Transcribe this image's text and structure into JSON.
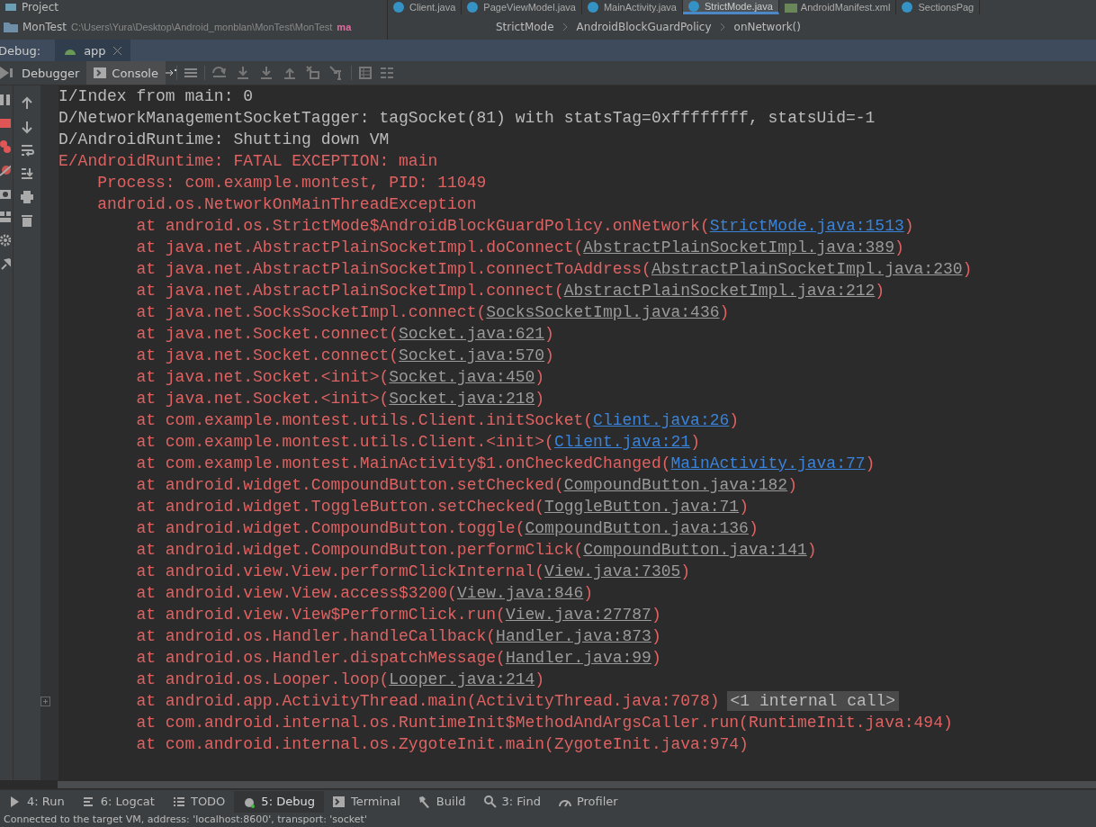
{
  "project_bar": {
    "title": "Project",
    "module": "MonTest",
    "path": "C:\\Users\\Yura\\Desktop\\Android_monblan\\MonTest\\MonTest",
    "branch": "ma"
  },
  "editor_tabs": [
    {
      "label": "Client.java",
      "kind": "class",
      "selected": false
    },
    {
      "label": "PageViewModel.java",
      "kind": "class",
      "selected": false
    },
    {
      "label": "MainActivity.java",
      "kind": "class",
      "selected": false
    },
    {
      "label": "StrictMode.java",
      "kind": "class",
      "selected": true
    },
    {
      "label": "AndroidManifest.xml",
      "kind": "manifest",
      "selected": false
    },
    {
      "label": "SectionsPag",
      "kind": "class",
      "selected": false
    }
  ],
  "breadcrumbs": [
    "StrictMode",
    "AndroidBlockGuardPolicy",
    "onNetwork()"
  ],
  "debug_bar": {
    "label": "Debug:",
    "session": "app"
  },
  "debug_tabs": [
    {
      "label": "Debugger",
      "selected": false
    },
    {
      "label": "Console",
      "selected": true
    }
  ],
  "console_lines": [
    {
      "kind": "info",
      "text": "I/Index from main: 0"
    },
    {
      "kind": "info",
      "text": "D/NetworkManagementSocketTagger: tagSocket(81) with statsTag=0xffffffff, statsUid=-1"
    },
    {
      "kind": "info",
      "text": "D/AndroidRuntime: Shutting down VM"
    },
    {
      "kind": "error",
      "text": "E/AndroidRuntime: FATAL EXCEPTION: main",
      "children": [
        {
          "kind": "error",
          "text": "Process: com.example.montest, PID: 11049"
        },
        {
          "kind": "error",
          "text": "android.os.NetworkOnMainThreadException",
          "children": [
            {
              "kind": "error",
              "text": "at android.os.StrictMode$AndroidBlockGuardPolicy.onNetwork(",
              "link": {
                "text": "StrictMode.java:1513",
                "kind": "project"
              },
              "tail": ")"
            },
            {
              "kind": "error",
              "text": "at java.net.AbstractPlainSocketImpl.doConnect(",
              "link": {
                "text": "AbstractPlainSocketImpl.java:389",
                "kind": "library"
              },
              "tail": ")"
            },
            {
              "kind": "error",
              "text": "at java.net.AbstractPlainSocketImpl.connectToAddress(",
              "link": {
                "text": "AbstractPlainSocketImpl.java:230",
                "kind": "library"
              },
              "tail": ")"
            },
            {
              "kind": "error",
              "text": "at java.net.AbstractPlainSocketImpl.connect(",
              "link": {
                "text": "AbstractPlainSocketImpl.java:212",
                "kind": "library"
              },
              "tail": ")"
            },
            {
              "kind": "error",
              "text": "at java.net.SocksSocketImpl.connect(",
              "link": {
                "text": "SocksSocketImpl.java:436",
                "kind": "library"
              },
              "tail": ")"
            },
            {
              "kind": "error",
              "text": "at java.net.Socket.connect(",
              "link": {
                "text": "Socket.java:621",
                "kind": "library"
              },
              "tail": ")"
            },
            {
              "kind": "error",
              "text": "at java.net.Socket.connect(",
              "link": {
                "text": "Socket.java:570",
                "kind": "library"
              },
              "tail": ")"
            },
            {
              "kind": "error",
              "text": "at java.net.Socket.<init>(",
              "link": {
                "text": "Socket.java:450",
                "kind": "library"
              },
              "tail": ")"
            },
            {
              "kind": "error",
              "text": "at java.net.Socket.<init>(",
              "link": {
                "text": "Socket.java:218",
                "kind": "library"
              },
              "tail": ")"
            },
            {
              "kind": "error",
              "text": "at com.example.montest.utils.Client.initSocket(",
              "link": {
                "text": "Client.java:26",
                "kind": "project"
              },
              "tail": ")"
            },
            {
              "kind": "error",
              "text": "at com.example.montest.utils.Client.<init>(",
              "link": {
                "text": "Client.java:21",
                "kind": "project"
              },
              "tail": ")"
            },
            {
              "kind": "error",
              "text": "at com.example.montest.MainActivity$1.onCheckedChanged(",
              "link": {
                "text": "MainActivity.java:77",
                "kind": "project"
              },
              "tail": ")"
            },
            {
              "kind": "error",
              "text": "at android.widget.CompoundButton.setChecked(",
              "link": {
                "text": "CompoundButton.java:182",
                "kind": "library"
              },
              "tail": ")"
            },
            {
              "kind": "error",
              "text": "at android.widget.ToggleButton.setChecked(",
              "link": {
                "text": "ToggleButton.java:71",
                "kind": "library"
              },
              "tail": ")"
            },
            {
              "kind": "error",
              "text": "at android.widget.CompoundButton.toggle(",
              "link": {
                "text": "CompoundButton.java:136",
                "kind": "library"
              },
              "tail": ")"
            },
            {
              "kind": "error",
              "text": "at android.widget.CompoundButton.performClick(",
              "link": {
                "text": "CompoundButton.java:141",
                "kind": "library"
              },
              "tail": ")"
            },
            {
              "kind": "error",
              "text": "at android.view.View.performClickInternal(",
              "link": {
                "text": "View.java:7305",
                "kind": "library"
              },
              "tail": ")"
            },
            {
              "kind": "error",
              "text": "at android.view.View.access$3200(",
              "link": {
                "text": "View.java:846",
                "kind": "library"
              },
              "tail": ")"
            },
            {
              "kind": "error",
              "text": "at android.view.View$PerformClick.run(",
              "link": {
                "text": "View.java:27787",
                "kind": "library"
              },
              "tail": ")"
            },
            {
              "kind": "error",
              "text": "at android.os.Handler.handleCallback(",
              "link": {
                "text": "Handler.java:873",
                "kind": "library"
              },
              "tail": ")"
            },
            {
              "kind": "error",
              "text": "at android.os.Handler.dispatchMessage(",
              "link": {
                "text": "Handler.java:99",
                "kind": "library"
              },
              "tail": ")"
            },
            {
              "kind": "error",
              "text": "at android.os.Looper.loop(",
              "link": {
                "text": "Looper.java:214",
                "kind": "library"
              },
              "tail": ")"
            },
            {
              "kind": "error",
              "text": "at android.app.ActivityThread.main(ActivityThread.java:7078)",
              "folded": "<1 internal call>"
            },
            {
              "kind": "error",
              "text": "at com.android.internal.os.RuntimeInit$MethodAndArgsCaller.run(RuntimeInit.java:494)"
            },
            {
              "kind": "error",
              "text": "at com.android.internal.os.ZygoteInit.main(ZygoteInit.java:974)"
            }
          ]
        }
      ]
    }
  ],
  "tool_windows": [
    {
      "label": "4: Run",
      "kind": "run",
      "selected": false
    },
    {
      "label": "6: Logcat",
      "kind": "logcat",
      "selected": false
    },
    {
      "label": "TODO",
      "kind": "todo",
      "selected": false
    },
    {
      "label": "5: Debug",
      "kind": "debug",
      "selected": true
    },
    {
      "label": "Terminal",
      "kind": "terminal",
      "selected": false
    },
    {
      "label": "Build",
      "kind": "build",
      "selected": false
    },
    {
      "label": "3: Find",
      "kind": "find",
      "selected": false
    },
    {
      "label": "Profiler",
      "kind": "profiler",
      "selected": false
    }
  ],
  "status_bar": "Connected to the target VM, address: 'localhost:8600', transport: 'socket'"
}
